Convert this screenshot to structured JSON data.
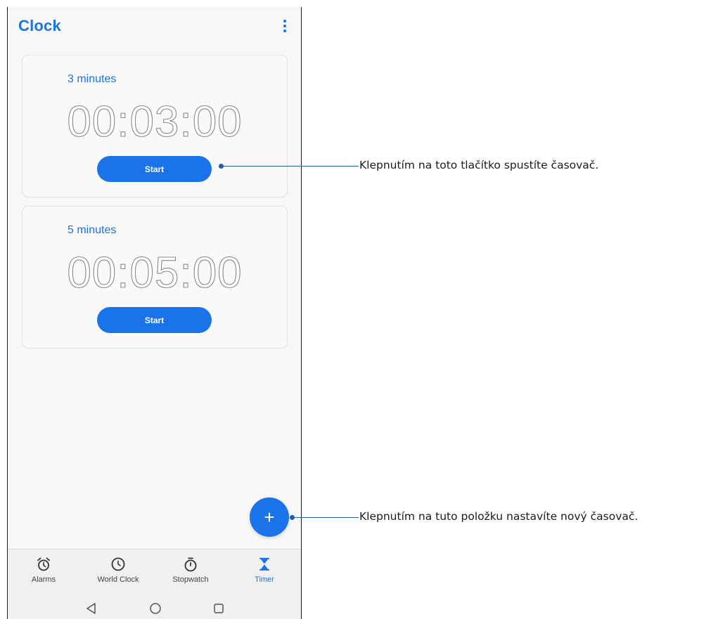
{
  "app": {
    "title": "Clock"
  },
  "timers": [
    {
      "label": "3 minutes",
      "time": "00:03:00",
      "button": "Start"
    },
    {
      "label": "5 minutes",
      "time": "00:05:00",
      "button": "Start"
    }
  ],
  "fab": {
    "symbol": "+"
  },
  "bottom_nav": {
    "items": [
      {
        "label": "Alarms",
        "icon": "alarm-icon"
      },
      {
        "label": "World Clock",
        "icon": "clock-icon"
      },
      {
        "label": "Stopwatch",
        "icon": "stopwatch-icon"
      },
      {
        "label": "Timer",
        "icon": "hourglass-icon",
        "active": true
      }
    ]
  },
  "system_nav": [
    "back-icon",
    "home-icon",
    "recents-icon"
  ],
  "callouts": [
    {
      "text": "Klepnutím na toto tlačítko spustíte časovač."
    },
    {
      "text": "Klepnutím na tuto položku nastavíte nový časovač."
    }
  ],
  "colors": {
    "accent": "#1a73e8",
    "callout": "#1f5fa8",
    "background": "#f7f7f7"
  }
}
